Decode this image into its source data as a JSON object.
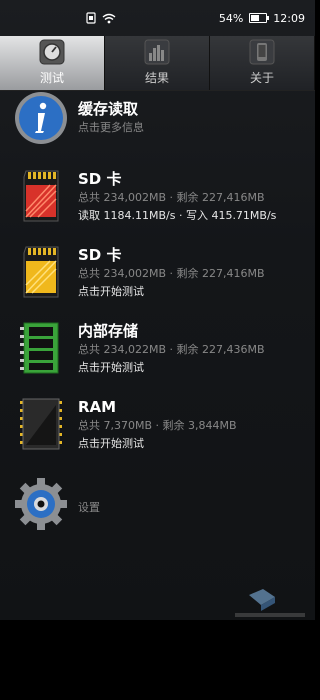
{
  "status_bar": {
    "battery": "54%",
    "time": "12:09"
  },
  "tabs": [
    {
      "label": "测试",
      "icon": "gauge-icon",
      "active": true
    },
    {
      "label": "结果",
      "icon": "bar-chart-icon",
      "active": false
    },
    {
      "label": "关于",
      "icon": "phone-icon",
      "active": false
    }
  ],
  "items": [
    {
      "icon": "info-icon",
      "title": "缓存读取",
      "line2": "点击更多信息",
      "line3": ""
    },
    {
      "icon": "sd-card-red-icon",
      "title": "SD 卡",
      "line2": "总共 234,002MB · 剩余 227,416MB",
      "line3": "读取 1184.11MB/s · 写入 415.71MB/s"
    },
    {
      "icon": "sd-card-yellow-icon",
      "title": "SD 卡",
      "line2": "总共 234,002MB · 剩余 227,416MB",
      "line3": "点击开始测试"
    },
    {
      "icon": "internal-storage-icon",
      "title": "内部存储",
      "line2": "总共 234,022MB · 剩余 227,436MB",
      "line3": "点击开始测试"
    },
    {
      "icon": "ram-chip-icon",
      "title": "RAM",
      "line2": "总共 7,370MB · 剩余 3,844MB",
      "line3": "点击开始测试"
    },
    {
      "icon": "settings-gear-icon",
      "title": "",
      "line2": "设置",
      "line3": ""
    }
  ],
  "colors": {
    "accent_blue": "#2c6fc4",
    "tab_active": "#c8c9cb",
    "sd_red": "#d8322a",
    "sd_yellow": "#f0b81c",
    "storage_green": "#3aa33a"
  }
}
